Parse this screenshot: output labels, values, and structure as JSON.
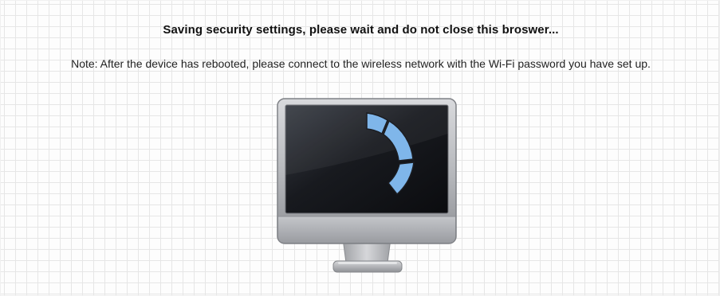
{
  "message": {
    "title": "Saving security settings, please wait and do not close this broswer...",
    "note": "Note: After the device has rebooted, please connect to the wireless network with the Wi-Fi password you have set up."
  },
  "illustration": {
    "icon": "monitor-icon",
    "spinner_icon": "loading-spinner-icon",
    "colors": {
      "bezel": "#9a9ca0",
      "screen": "#1b1d22",
      "spinner": "#7fb6ea"
    }
  }
}
